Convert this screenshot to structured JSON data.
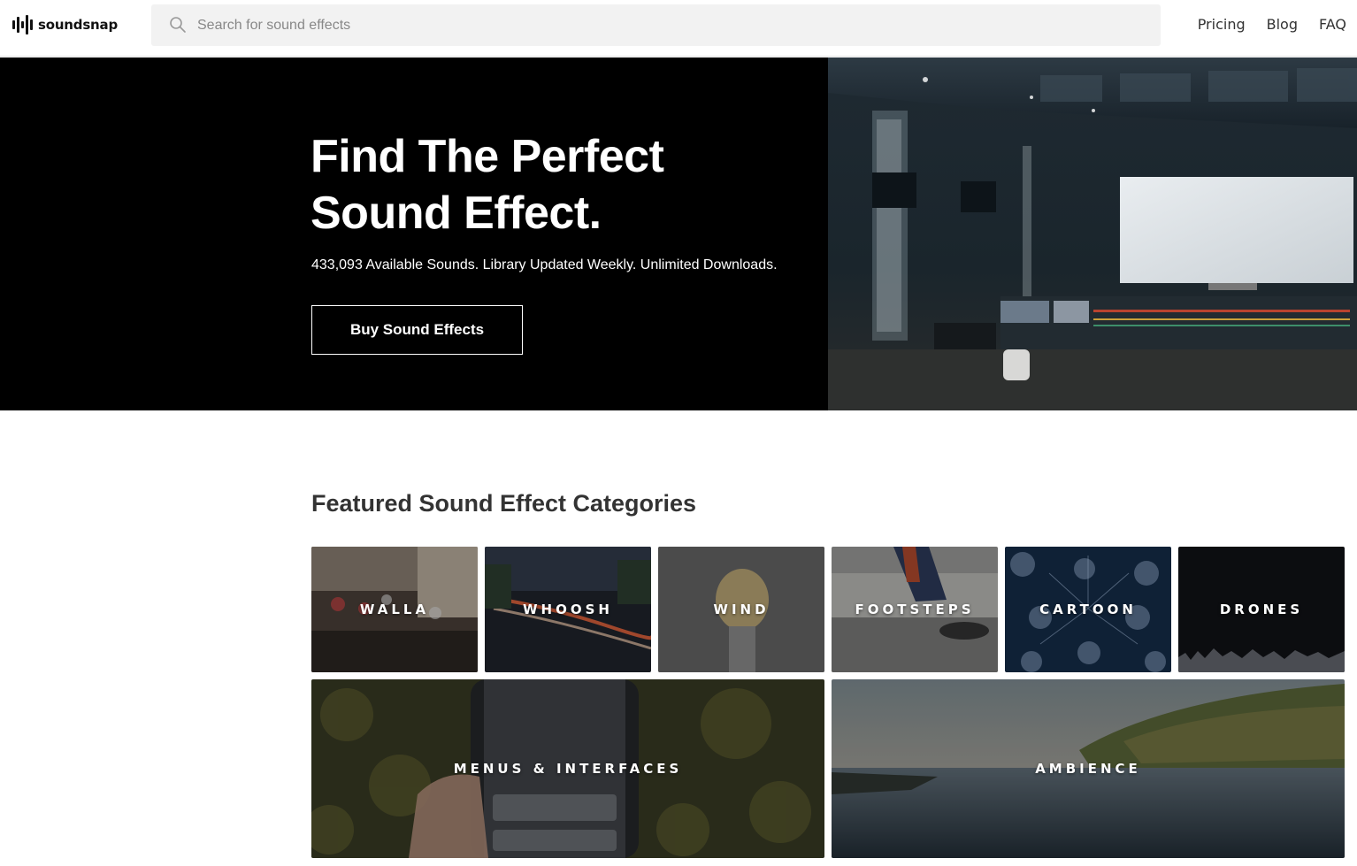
{
  "header": {
    "logo_text": "soundsnap",
    "search": {
      "placeholder": "Search for sound effects",
      "value": ""
    },
    "nav": [
      {
        "label": "Pricing"
      },
      {
        "label": "Blog"
      },
      {
        "label": "FAQ"
      }
    ]
  },
  "hero": {
    "title_line1": "Find The Perfect",
    "title_line2": "Sound Effect.",
    "subtitle": "433,093 Available Sounds. Library Updated Weekly. Unlimited Downloads.",
    "button_label": "Buy Sound Effects"
  },
  "featured": {
    "title": "Featured Sound Effect Categories",
    "categories": [
      {
        "label": "WALLA"
      },
      {
        "label": "WHOOSH"
      },
      {
        "label": "WIND"
      },
      {
        "label": "FOOTSTEPS"
      },
      {
        "label": "CARTOON"
      },
      {
        "label": "DRONES"
      },
      {
        "label": "MENUS & INTERFACES"
      },
      {
        "label": "AMBIENCE"
      }
    ]
  },
  "icons": {
    "search": "search-icon",
    "logo": "waveform-logo-icon"
  },
  "colors": {
    "hero_bg": "#000000",
    "header_search_bg": "#f2f2f2",
    "text": "#333333"
  }
}
